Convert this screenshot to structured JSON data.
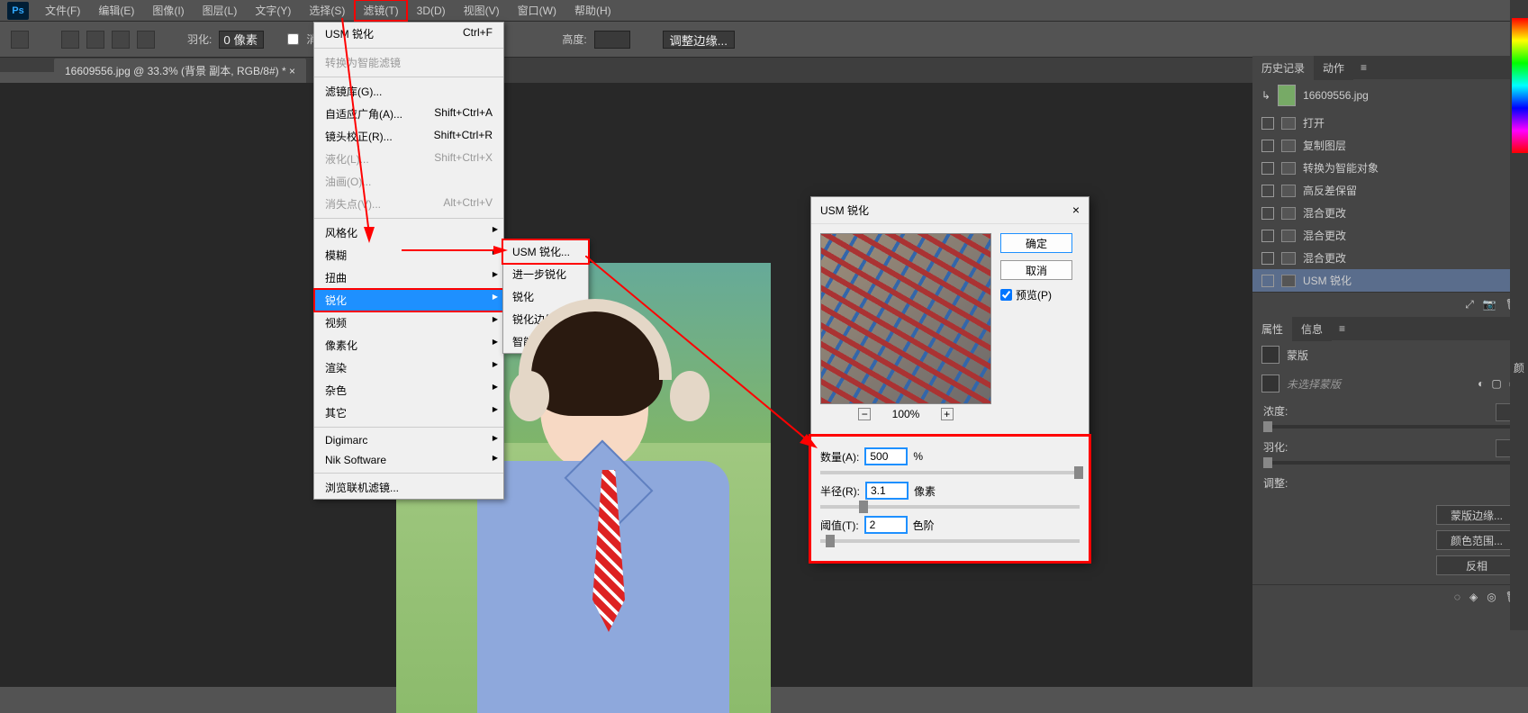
{
  "menubar": {
    "items": [
      "文件(F)",
      "编辑(E)",
      "图像(I)",
      "图层(L)",
      "文字(Y)",
      "选择(S)",
      "滤镜(T)",
      "3D(D)",
      "视图(V)",
      "窗口(W)",
      "帮助(H)"
    ]
  },
  "toolbar": {
    "feather_label": "羽化:",
    "feather_value": "0 像素",
    "antialias": "消除锯齿",
    "height_label": "高度:",
    "adjust_edge": "调整边缘..."
  },
  "document_tab": "16609556.jpg @ 33.3% (背景 副本, RGB/8#) * ×",
  "filter_menu": {
    "last": {
      "label": "USM 锐化",
      "shortcut": "Ctrl+F"
    },
    "convert": "转换为智能滤镜",
    "gallery": "滤镜库(G)...",
    "adaptive": {
      "label": "自适应广角(A)...",
      "shortcut": "Shift+Ctrl+A"
    },
    "lens": {
      "label": "镜头校正(R)...",
      "shortcut": "Shift+Ctrl+R"
    },
    "liquify": {
      "label": "液化(L)...",
      "shortcut": "Shift+Ctrl+X"
    },
    "oil": "油画(O)...",
    "vanish": {
      "label": "消失点(V)...",
      "shortcut": "Alt+Ctrl+V"
    },
    "groups": [
      "风格化",
      "模糊",
      "扭曲",
      "锐化",
      "视频",
      "像素化",
      "渲染",
      "杂色",
      "其它"
    ],
    "extra": [
      "Digimarc",
      "Nik Software"
    ],
    "browse": "浏览联机滤镜..."
  },
  "sharpen_submenu": [
    "USM 锐化...",
    "进一步锐化",
    "锐化",
    "锐化边缘",
    "智能锐化..."
  ],
  "dialog": {
    "title": "USM 锐化",
    "ok": "确定",
    "cancel": "取消",
    "preview_chk": "预览(P)",
    "zoom": "100%",
    "amount_label": "数量(A):",
    "amount_value": "500",
    "amount_unit": "%",
    "radius_label": "半径(R):",
    "radius_value": "3.1",
    "radius_unit": "像素",
    "threshold_label": "阈值(T):",
    "threshold_value": "2",
    "threshold_unit": "色阶"
  },
  "history": {
    "tab1": "历史记录",
    "tab2": "动作",
    "filename": "16609556.jpg",
    "items": [
      "打开",
      "复制图层",
      "转换为智能对象",
      "高反差保留",
      "混合更改",
      "混合更改",
      "混合更改",
      "USM 锐化"
    ]
  },
  "properties": {
    "tab1": "属性",
    "tab2": "信息",
    "mask_label": "蒙版",
    "no_mask": "未选择蒙版",
    "density_label": "浓度:",
    "feather_label": "羽化:",
    "adjust_label": "调整:",
    "btn_mask_edge": "蒙版边缘...",
    "btn_color_range": "颜色范围...",
    "btn_invert": "反相"
  },
  "right_strip_label": "颜"
}
